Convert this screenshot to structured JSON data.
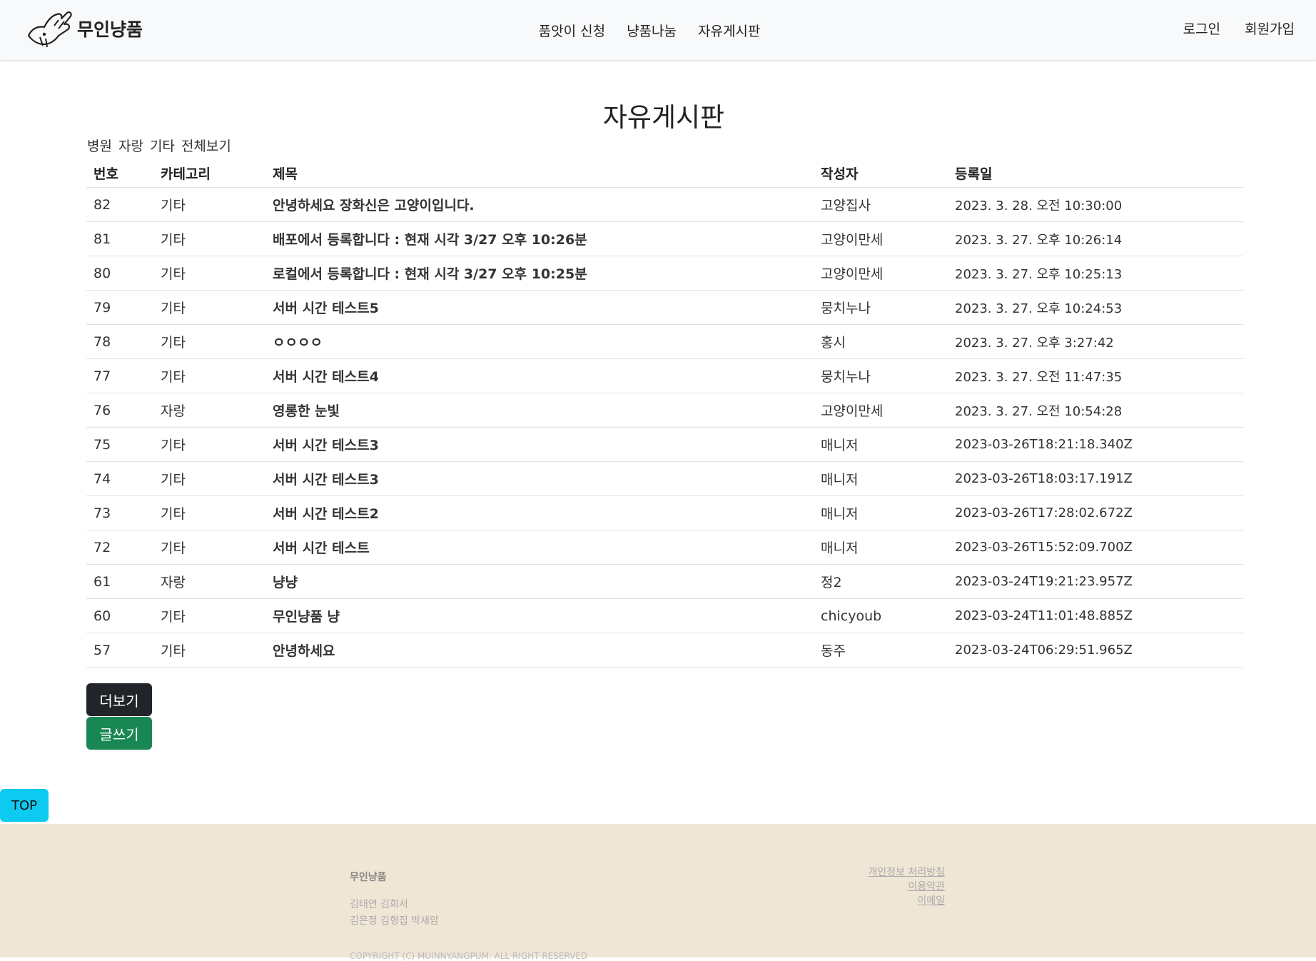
{
  "header": {
    "logo_text": "무인냥품",
    "nav": [
      "품앗이 신청",
      "냥품나눔",
      "자유게시판"
    ],
    "login": "로그인",
    "signup": "회원가입"
  },
  "board": {
    "title": "자유게시판",
    "categories": [
      "병원",
      "자랑",
      "기타",
      "전체보기"
    ],
    "columns": [
      "번호",
      "카테고리",
      "제목",
      "작성자",
      "등록일"
    ],
    "rows": [
      {
        "no": "82",
        "cat": "기타",
        "title": "안녕하세요 장화신은 고양이입니다.",
        "author": "고양집사",
        "date": "2023. 3. 28. 오전 10:30:00"
      },
      {
        "no": "81",
        "cat": "기타",
        "title": "배포에서 등록합니다 : 현재 시각 3/27 오후 10:26분",
        "author": "고양이만세",
        "date": "2023. 3. 27. 오후 10:26:14"
      },
      {
        "no": "80",
        "cat": "기타",
        "title": "로컬에서 등록합니다 : 현재 시각 3/27 오후 10:25분",
        "author": "고양이만세",
        "date": "2023. 3. 27. 오후 10:25:13"
      },
      {
        "no": "79",
        "cat": "기타",
        "title": "서버 시간 테스트5",
        "author": "뭉치누나",
        "date": "2023. 3. 27. 오후 10:24:53"
      },
      {
        "no": "78",
        "cat": "기타",
        "title": "ㅇㅇㅇㅇ",
        "author": "홍시",
        "date": "2023. 3. 27. 오후 3:27:42"
      },
      {
        "no": "77",
        "cat": "기타",
        "title": "서버 시간 테스트4",
        "author": "뭉치누나",
        "date": "2023. 3. 27. 오전 11:47:35"
      },
      {
        "no": "76",
        "cat": "자랑",
        "title": "영롱한 눈빛",
        "author": "고양이만세",
        "date": "2023. 3. 27. 오전 10:54:28"
      },
      {
        "no": "75",
        "cat": "기타",
        "title": "서버 시간 테스트3",
        "author": "매니저",
        "date": "2023-03-26T18:21:18.340Z"
      },
      {
        "no": "74",
        "cat": "기타",
        "title": "서버 시간 테스트3",
        "author": "매니저",
        "date": "2023-03-26T18:03:17.191Z"
      },
      {
        "no": "73",
        "cat": "기타",
        "title": "서버 시간 테스트2",
        "author": "매니저",
        "date": "2023-03-26T17:28:02.672Z"
      },
      {
        "no": "72",
        "cat": "기타",
        "title": "서버 시간 테스트",
        "author": "매니저",
        "date": "2023-03-26T15:52:09.700Z"
      },
      {
        "no": "61",
        "cat": "자랑",
        "title": "냥냥",
        "author": "정2",
        "date": "2023-03-24T19:21:23.957Z"
      },
      {
        "no": "60",
        "cat": "기타",
        "title": "무인냥품 냥",
        "author": "chicyoub",
        "date": "2023-03-24T11:01:48.885Z"
      },
      {
        "no": "57",
        "cat": "기타",
        "title": "안녕하세요",
        "author": "동주",
        "date": "2023-03-24T06:29:51.965Z"
      }
    ],
    "more_label": "더보기",
    "write_label": "글쓰기",
    "top_label": "TOP"
  },
  "footer": {
    "brand": "무인냥품",
    "names_line1": "김태연 김희서",
    "names_line2": "김은정 김형집 박새암",
    "copyright": "COPYRIGHT (C) MUINNYANGPUM. ALL RIGHT RESERVED",
    "links": [
      "개인정보 처리방침",
      "이용약관",
      "이메일"
    ]
  },
  "colors": {
    "header_bg": "#f8f9fa",
    "more_button": "#212529",
    "write_button": "#198754",
    "top_button": "#0dcaf0",
    "footer_bg": "#f0e6d6"
  }
}
